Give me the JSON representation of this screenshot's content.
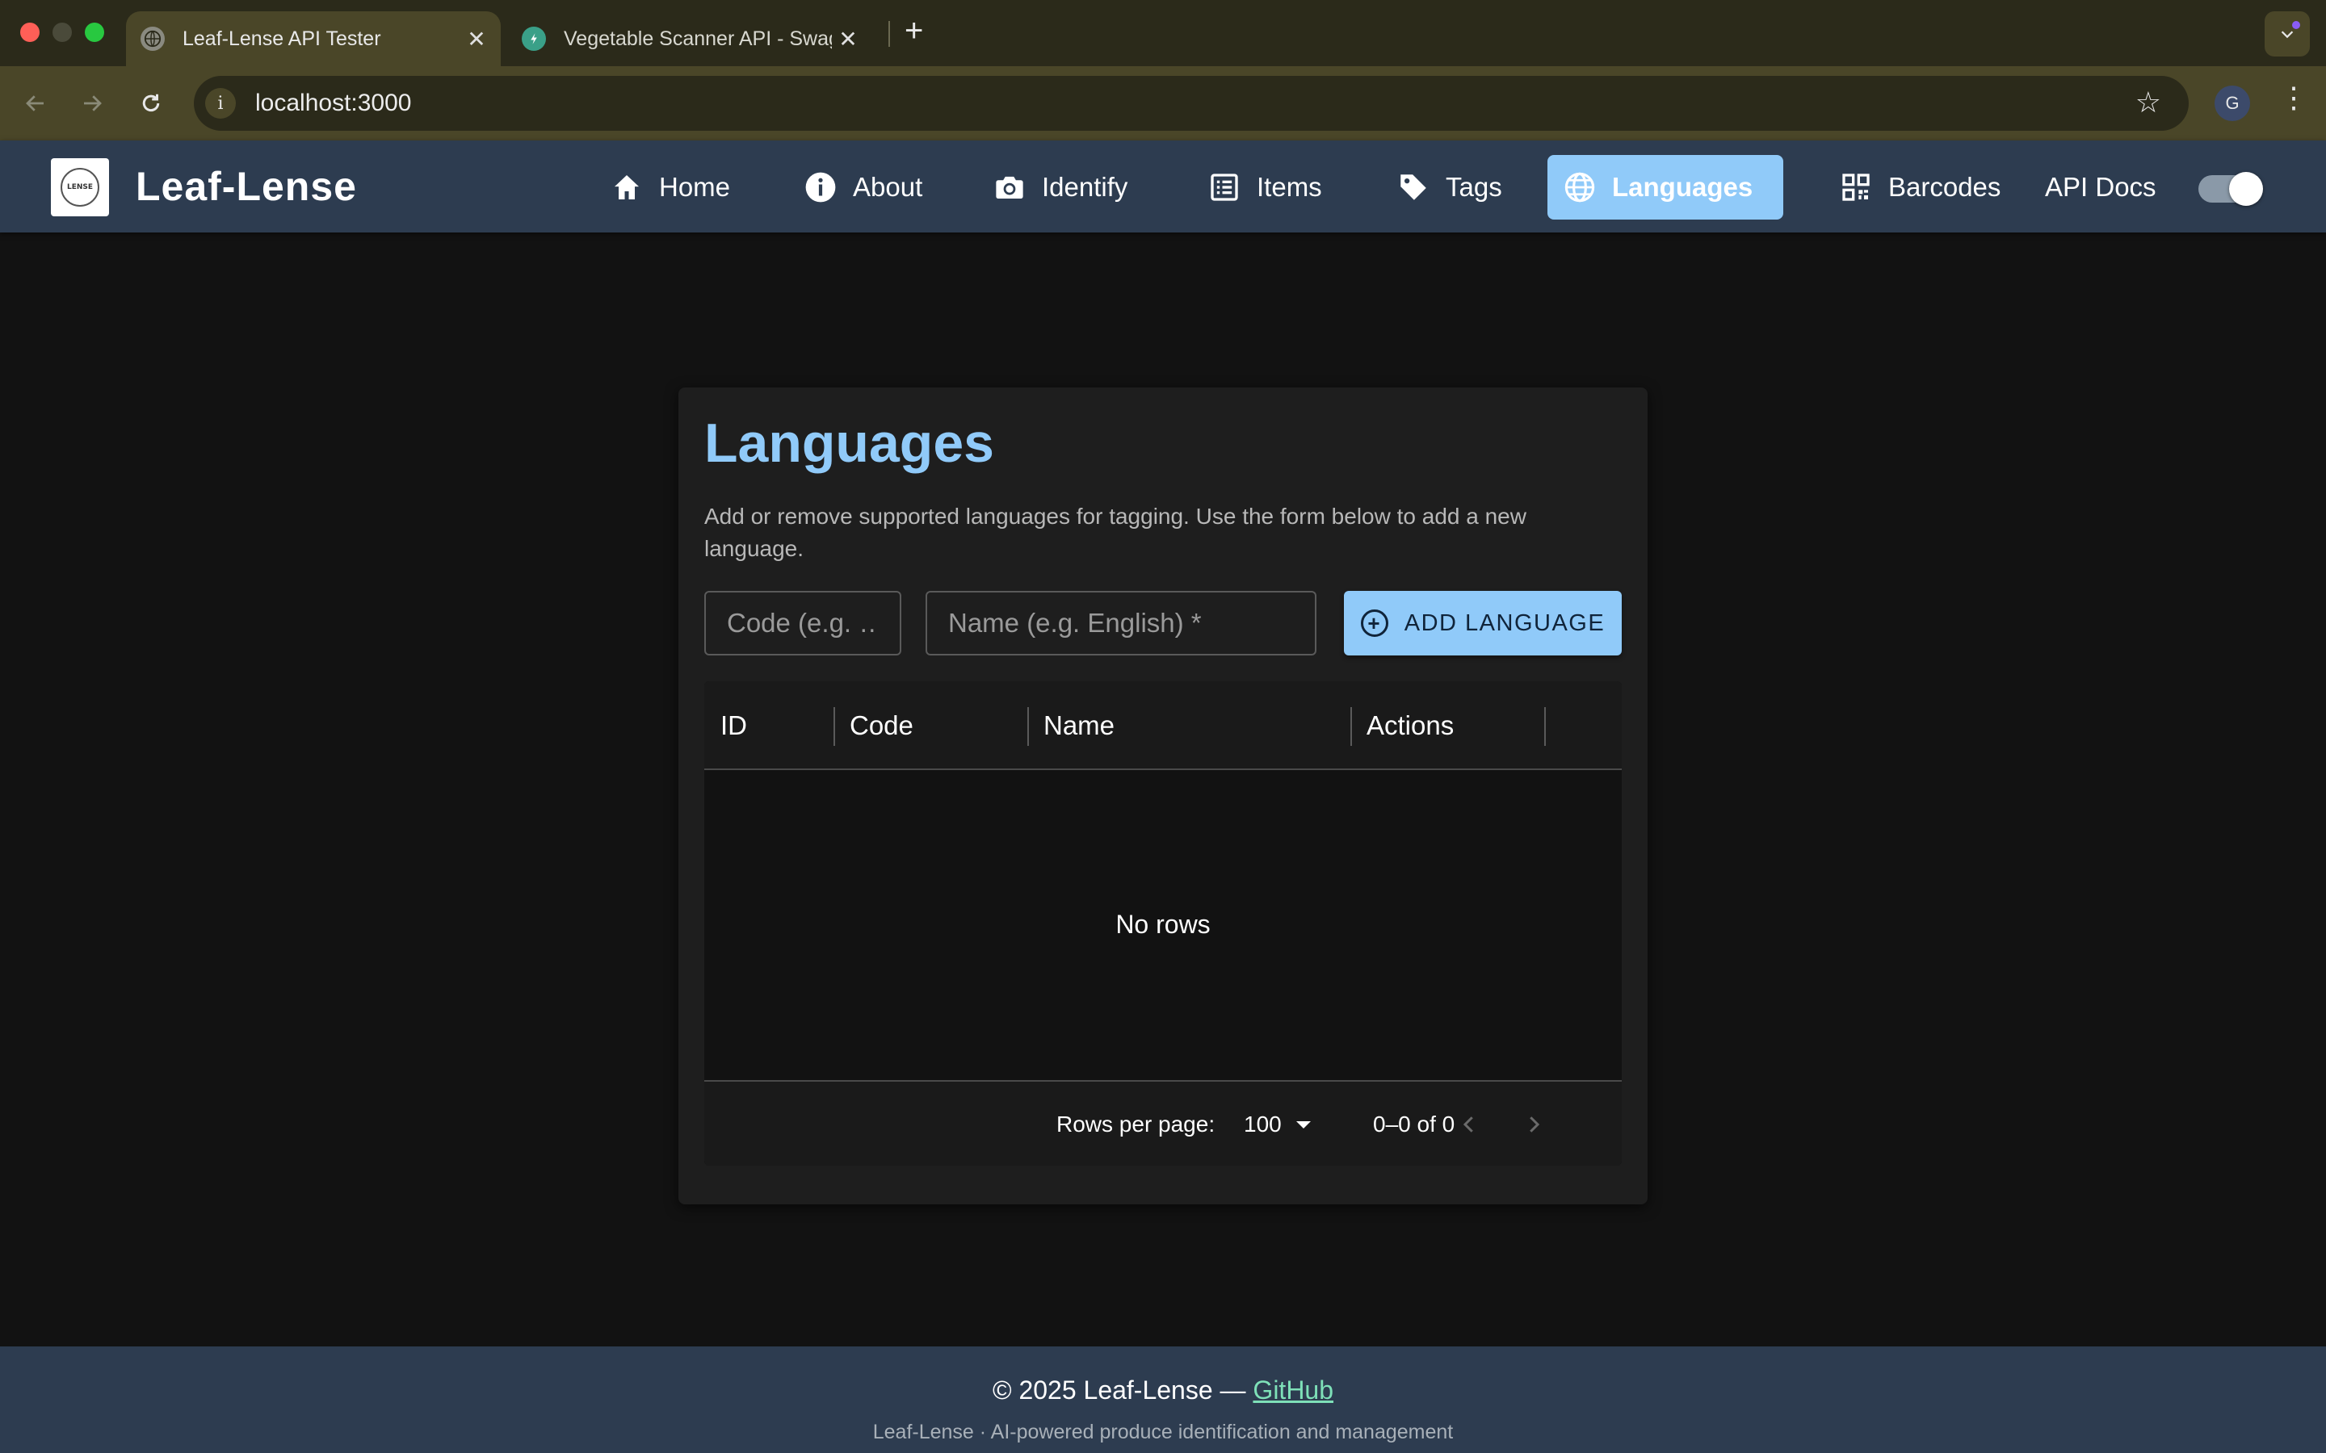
{
  "browser": {
    "tabs": [
      {
        "title": "Leaf-Lense API Tester",
        "active": true,
        "icon": "globe-icon"
      },
      {
        "title": "Vegetable Scanner API - Swagger UI",
        "active": false,
        "icon": "swagger-icon"
      }
    ],
    "url": "localhost:3000",
    "profile_initial": "G"
  },
  "app": {
    "brand": "Leaf-Lense",
    "logo_text": "LENSE",
    "nav": [
      {
        "label": "Home",
        "icon": "home-icon",
        "active": false
      },
      {
        "label": "About",
        "icon": "info-icon",
        "active": false
      },
      {
        "label": "Identify",
        "icon": "camera-icon",
        "active": false
      },
      {
        "label": "Items",
        "icon": "list-icon",
        "active": false
      },
      {
        "label": "Tags",
        "icon": "tag-icon",
        "active": false
      },
      {
        "label": "Languages",
        "icon": "globe-icon",
        "active": true
      },
      {
        "label": "Barcodes",
        "icon": "qr-code-icon",
        "active": false
      },
      {
        "label": "API Docs",
        "icon": "",
        "active": false
      }
    ],
    "theme_toggle": "on"
  },
  "page": {
    "title": "Languages",
    "description": "Add or remove supported languages for tagging. Use the form below to add a new language.",
    "form": {
      "code_placeholder": "Code (e.g. en)",
      "code_display": "Code (e.g. …",
      "name_placeholder": "Name (e.g. English) *",
      "add_label": "ADD LANGUAGE"
    },
    "table": {
      "columns": [
        "ID",
        "Code",
        "Name",
        "Actions"
      ],
      "rows": [],
      "empty_text": "No rows",
      "rows_per_page_label": "Rows per page:",
      "rows_per_page_value": "100",
      "range_text": "0–0 of 0"
    }
  },
  "footer": {
    "copyright": "© 2025 Leaf-Lense — ",
    "link_label": "GitHub",
    "tagline": "Leaf-Lense · AI-powered produce identification and management"
  },
  "colors": {
    "accent": "#90caf9",
    "appbar": "#2d3c50",
    "background": "#121212",
    "link": "#7ee0b8"
  }
}
